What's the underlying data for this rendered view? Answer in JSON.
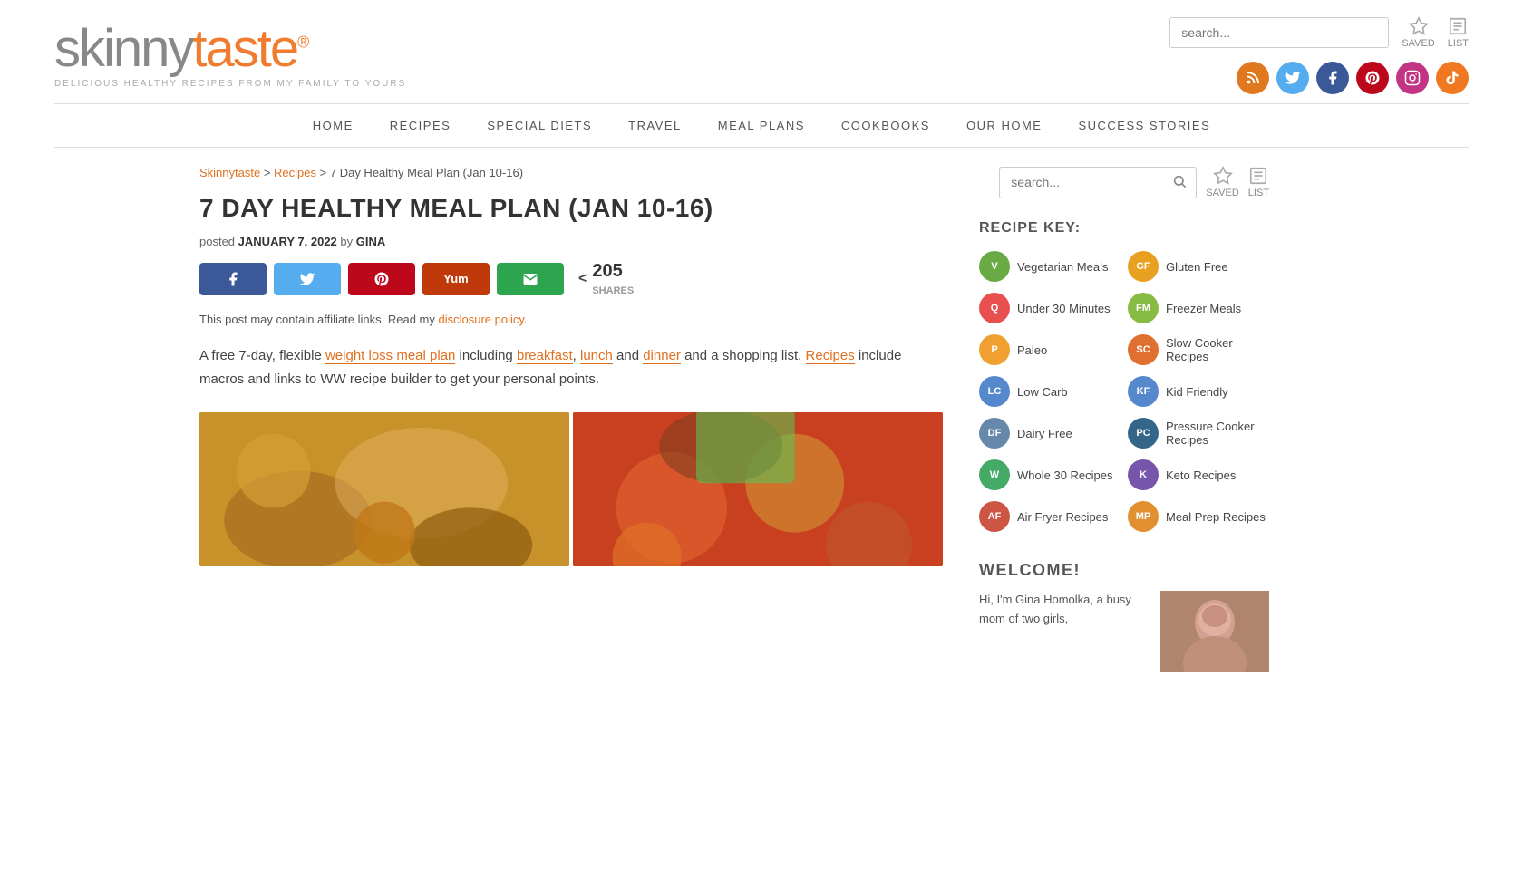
{
  "site": {
    "name_gray": "skinnytaste",
    "name_orange": "taste",
    "name_prefix": "skinny",
    "registered": "®",
    "tagline": "DELICIOUS HEALTHY RECIPES FROM MY FAMILY TO YOURS"
  },
  "header": {
    "search_placeholder": "search...",
    "saved_label": "SAVED",
    "list_label": "LIST"
  },
  "social": [
    {
      "name": "rss",
      "color": "#e07820",
      "symbol": "◉"
    },
    {
      "name": "twitter",
      "color": "#55acee",
      "symbol": "𝕋"
    },
    {
      "name": "facebook",
      "color": "#3b5998",
      "symbol": "f"
    },
    {
      "name": "pinterest",
      "color": "#bd081c",
      "symbol": "P"
    },
    {
      "name": "instagram",
      "color": "#c13584",
      "symbol": "📷"
    },
    {
      "name": "tiktok",
      "color": "#f07820",
      "symbol": "♪"
    }
  ],
  "nav": {
    "items": [
      {
        "label": "HOME",
        "href": "#"
      },
      {
        "label": "RECIPES",
        "href": "#"
      },
      {
        "label": "SPECIAL DIETS",
        "href": "#"
      },
      {
        "label": "TRAVEL",
        "href": "#"
      },
      {
        "label": "MEAL PLANS",
        "href": "#"
      },
      {
        "label": "COOKBOOKS",
        "href": "#"
      },
      {
        "label": "OUR HOME",
        "href": "#"
      },
      {
        "label": "SUCCESS STORIES",
        "href": "#"
      }
    ]
  },
  "breadcrumb": {
    "items": [
      {
        "label": "Skinnytaste",
        "href": "#"
      },
      {
        "label": "Recipes",
        "href": "#"
      }
    ],
    "current": "7 Day Healthy Meal Plan (Jan 10-16)"
  },
  "article": {
    "title": "7 DAY HEALTHY MEAL PLAN (JAN 10-16)",
    "posted_label": "posted",
    "date": "JANUARY 7, 2022",
    "by_label": "by",
    "author": "GINA",
    "shares_count": "205",
    "shares_label": "SHARES",
    "disclosure_text": "This post may contain affiliate links. Read my",
    "disclosure_link": "disclosure policy",
    "body_text_1": "A free 7-day, flexible",
    "body_link_1": "weight loss meal plan",
    "body_text_2": "including",
    "body_link_2": "breakfast",
    "body_text_3": ",",
    "body_link_3": "lunch",
    "body_text_4": "and",
    "body_link_4": "dinner",
    "body_text_5": "and a shopping list.",
    "body_link_5": "Recipes",
    "body_text_6": "include macros and links to WW recipe builder to get your personal points."
  },
  "share_buttons": [
    {
      "name": "facebook-share",
      "color": "#3b5998",
      "symbol": "f"
    },
    {
      "name": "twitter-share",
      "color": "#55acee",
      "symbol": "t"
    },
    {
      "name": "pinterest-share",
      "color": "#bd081c",
      "symbol": "P"
    },
    {
      "name": "yummly-share",
      "color": "#c0390a",
      "symbol": "Y"
    },
    {
      "name": "email-share",
      "color": "#2da44e",
      "symbol": "✉"
    }
  ],
  "sidebar": {
    "search_placeholder": "search...",
    "saved_label": "SAVED",
    "list_label": "LIST",
    "recipe_key_title": "RECIPE KEY:",
    "recipe_key_items": [
      {
        "badge": "V",
        "color": "#6aaa44",
        "label": "Vegetarian Meals"
      },
      {
        "badge": "GF",
        "color": "#e8a020",
        "label": "Gluten Free"
      },
      {
        "badge": "Q",
        "color": "#e85050",
        "label": "Under 30 Minutes"
      },
      {
        "badge": "FM",
        "color": "#88bb44",
        "label": "Freezer Meals"
      },
      {
        "badge": "P",
        "color": "#f0a030",
        "label": "Paleo"
      },
      {
        "badge": "SC",
        "color": "#e07030",
        "label": "Slow Cooker Recipes"
      },
      {
        "badge": "LC",
        "color": "#5588cc",
        "label": "Low Carb"
      },
      {
        "badge": "KF",
        "color": "#5588cc",
        "label": "Kid Friendly"
      },
      {
        "badge": "DF",
        "color": "#6688aa",
        "label": "Dairy Free"
      },
      {
        "badge": "PC",
        "color": "#336688",
        "label": "Pressure Cooker Recipes"
      },
      {
        "badge": "W",
        "color": "#44aa66",
        "label": "Whole 30 Recipes"
      },
      {
        "badge": "K",
        "color": "#7755aa",
        "label": "Keto Recipes"
      },
      {
        "badge": "AF",
        "color": "#cc5544",
        "label": "Air Fryer Recipes"
      },
      {
        "badge": "MP",
        "color": "#e09030",
        "label": "Meal Prep Recipes"
      }
    ],
    "welcome_title": "WELCOME!",
    "welcome_text": "Hi, I'm Gina Homolka, a busy mom of two girls,"
  }
}
